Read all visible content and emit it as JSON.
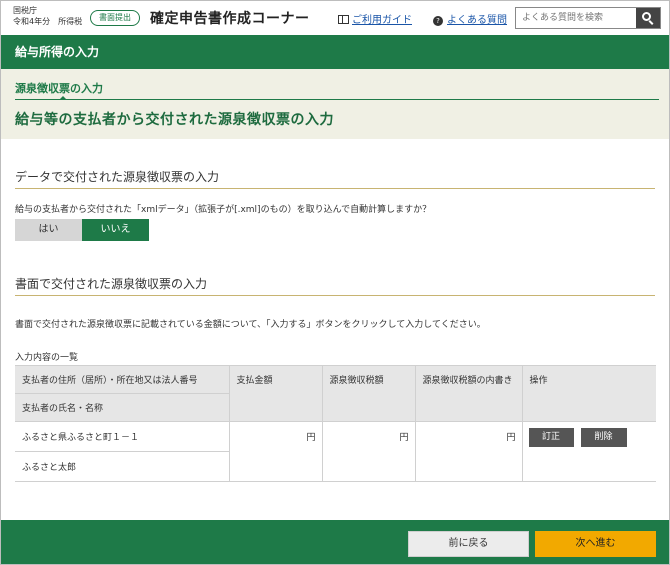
{
  "header": {
    "agency_line1": "国税庁",
    "agency_line2": "令和4年分　所得税",
    "badge": "書面提出",
    "app_title": "確定申告書作成コーナー",
    "guide_link": "ご利用ガイド",
    "faq_link": "よくある質問",
    "search_placeholder": "よくある質問を検索"
  },
  "section_band": "給与所得の入力",
  "breadcrumb": "源泉徴収票の入力",
  "page_heading": "給与等の支払者から交付された源泉徴収票の入力",
  "data_section": {
    "title": "データで交付された源泉徴収票の入力",
    "question": "給与の支払者から交付された「xmlデータ」（拡張子が[.xml]のもの）を取り込んで自動計算しますか？",
    "yes_label": "はい",
    "no_label": "いいえ",
    "selected": "いいえ"
  },
  "paper_section": {
    "title": "書面で交付された源泉徴収票の入力",
    "instruction": "書面で交付された源泉徴収票に記載されている金額について、「入力する」ボタンをクリックして入力してください。"
  },
  "table": {
    "label": "入力内容の一覧",
    "headers": {
      "payer_address": "支払者の住所（居所）・所在地又は法人番号",
      "payer_name": "支払者の氏名・名称",
      "amount": "支払金額",
      "withholding": "源泉徴収税額",
      "withholding_detail": "源泉徴収税額の内書き",
      "actions": "操作"
    },
    "rows": [
      {
        "address": "ふるさと県ふるさと町１－１",
        "name": "ふるさと太郎",
        "amount_unit": "円",
        "withholding_unit": "円",
        "detail_unit": "円",
        "edit_label": "訂正",
        "delete_label": "削除"
      }
    ]
  },
  "footer": {
    "back_label": "前に戻る",
    "next_label": "次へ進む"
  },
  "colors": {
    "primary_green": "#1e7a48",
    "beige": "#f0f0e4",
    "next_button": "#f2a900"
  }
}
